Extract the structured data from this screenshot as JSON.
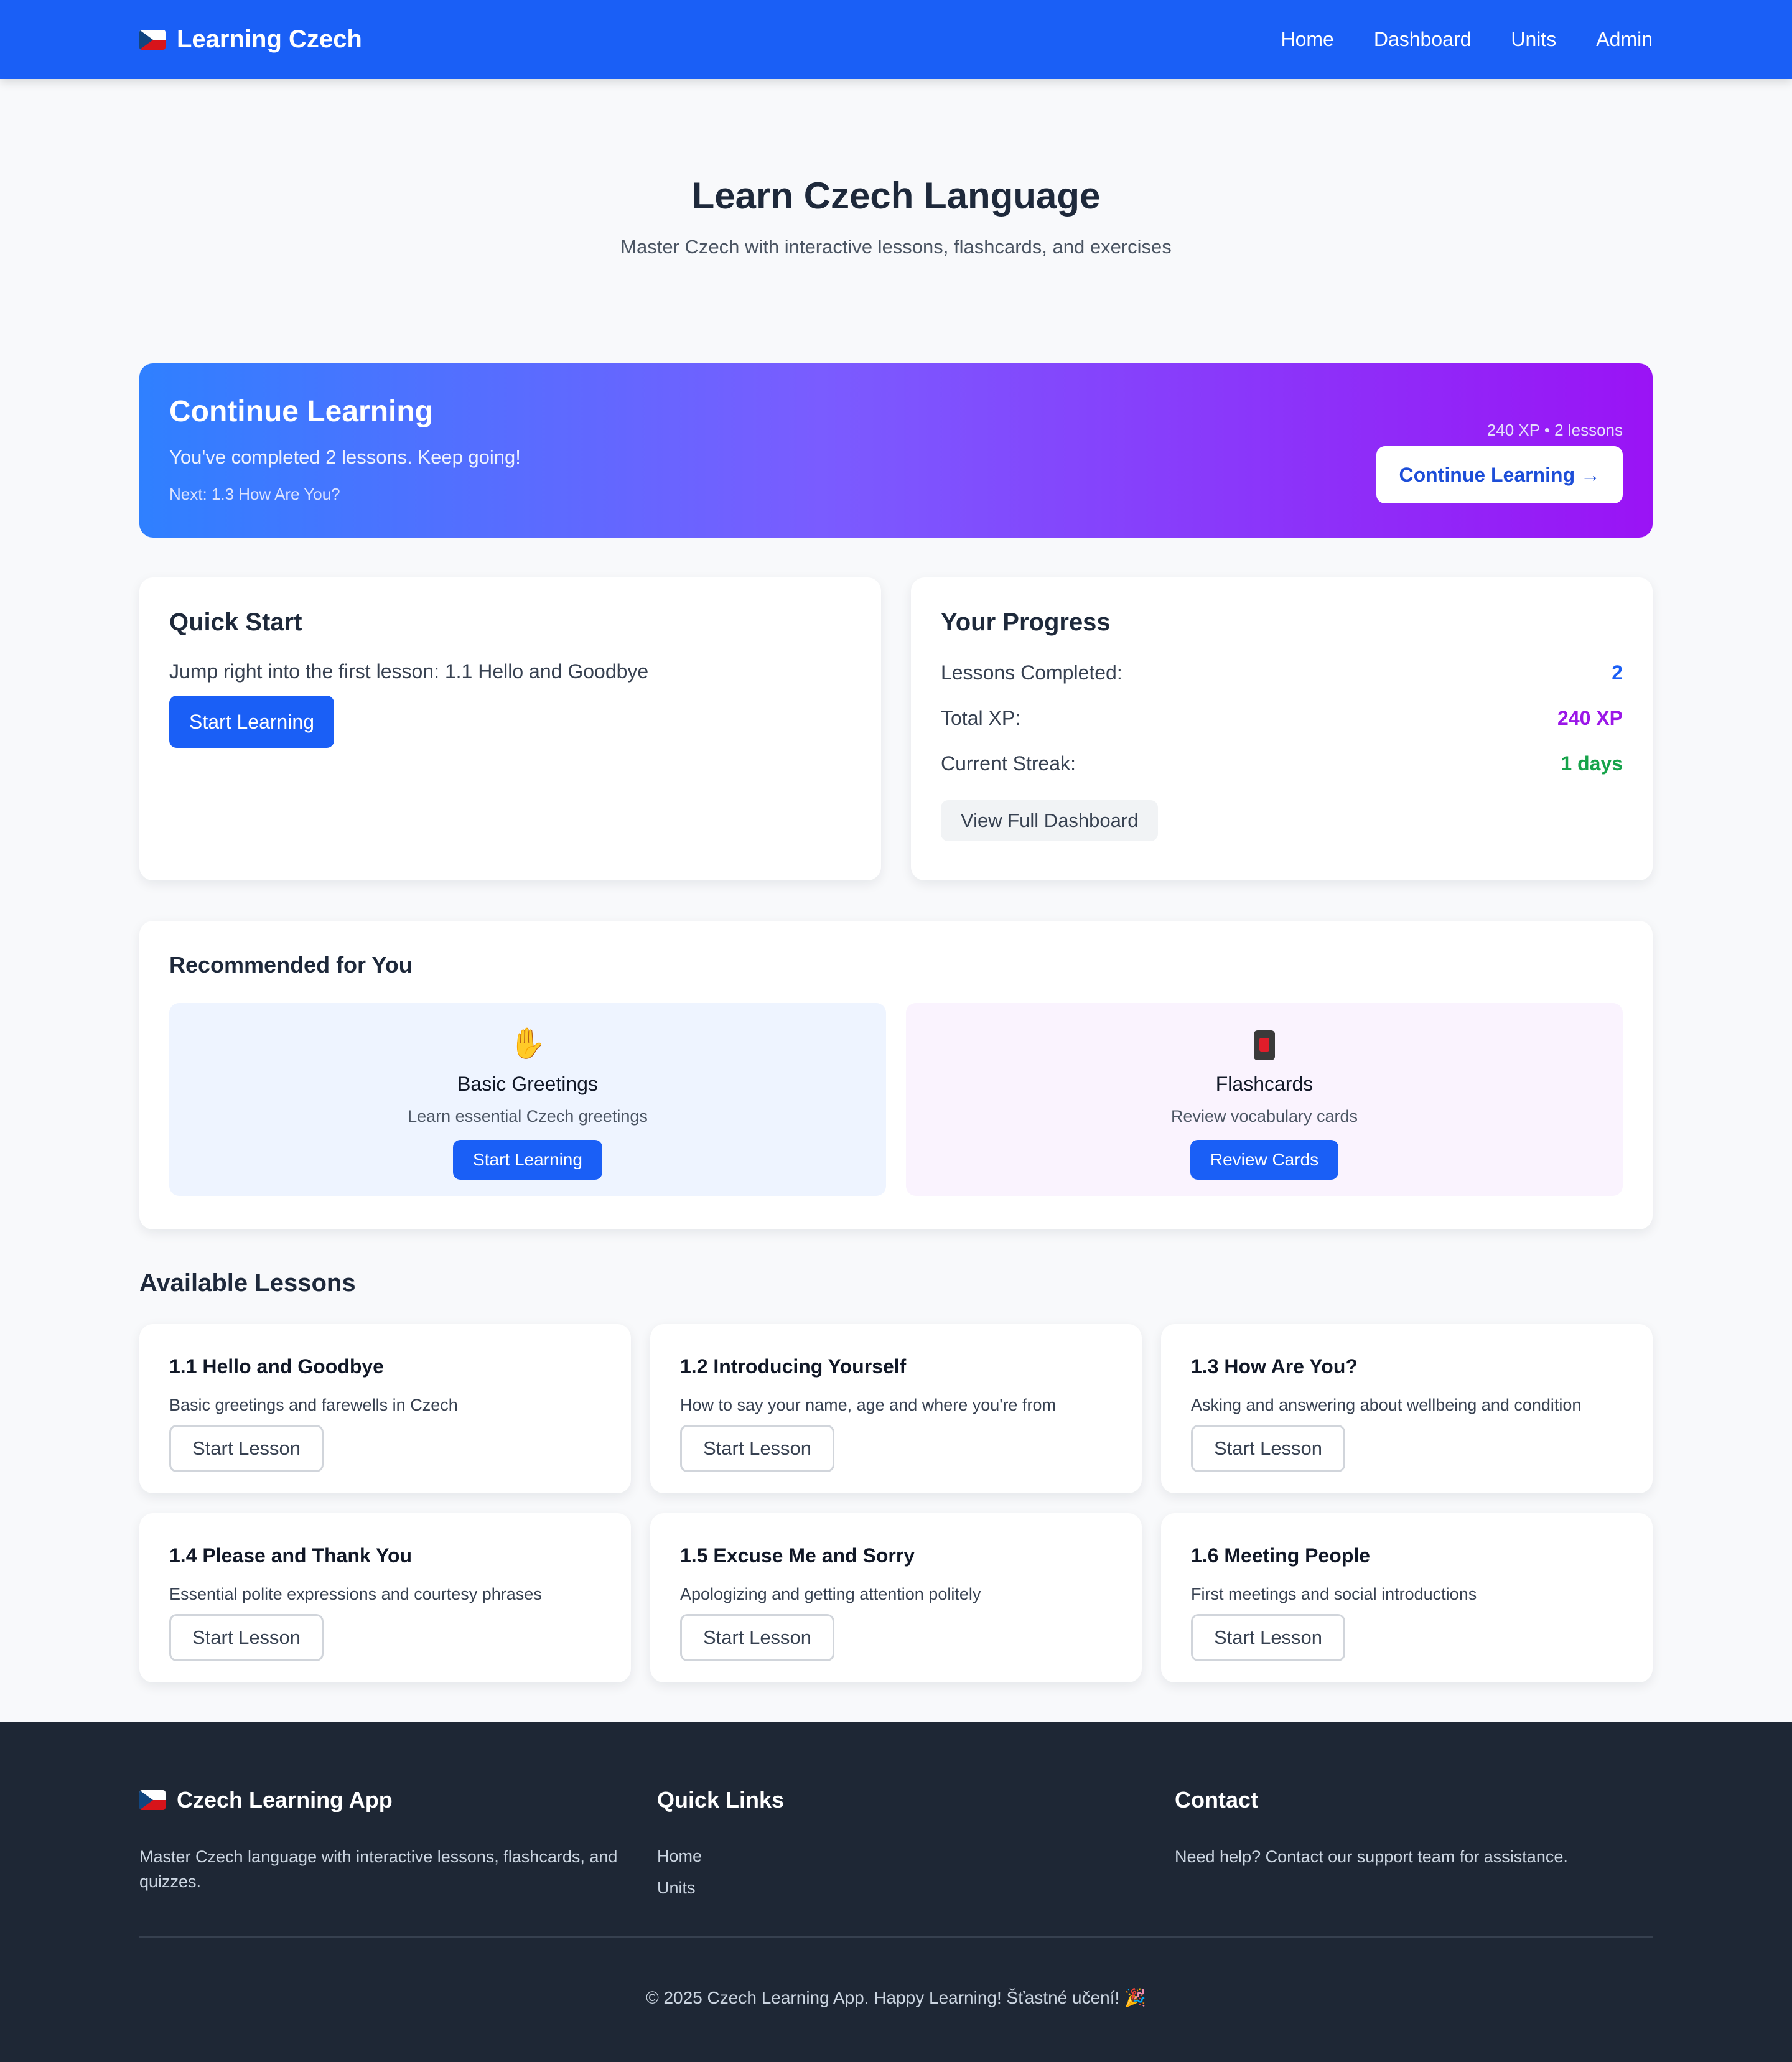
{
  "nav": {
    "brand": "Learning Czech",
    "links": [
      "Home",
      "Dashboard",
      "Units",
      "Admin"
    ]
  },
  "hero": {
    "title": "Learn Czech Language",
    "subtitle": "Master Czech with interactive lessons, flashcards, and exercises"
  },
  "continue": {
    "title": "Continue Learning",
    "subtitle": "You've completed 2 lessons. Keep going!",
    "next": "Next: 1.3 How Are You?",
    "stats": "240 XP • 2 lessons",
    "button": "Continue Learning →",
    "gradient_from": "#2f80ff",
    "gradient_to": "#9a13f5"
  },
  "quick_start": {
    "title": "Quick Start",
    "description": "Jump right into the first lesson: 1.1 Hello and Goodbye",
    "button": "Start Learning"
  },
  "progress": {
    "title": "Your Progress",
    "rows": [
      {
        "label": "Lessons Completed:",
        "value": "2"
      },
      {
        "label": "Total XP:",
        "value": "240 XP"
      },
      {
        "label": "Current Streak:",
        "value": "1 days"
      }
    ],
    "button": "View Full Dashboard"
  },
  "recommended": {
    "title": "Recommended for You",
    "items": [
      {
        "icon": "waving-hand-icon",
        "title": "Basic Greetings",
        "description": "Learn essential Czech greetings",
        "button": "Start Learning"
      },
      {
        "icon": "flashcard-icon",
        "title": "Flashcards",
        "description": "Review vocabulary cards",
        "button": "Review Cards"
      }
    ]
  },
  "lessons": {
    "title": "Available Lessons",
    "items": [
      {
        "title": "1.1 Hello and Goodbye",
        "description": "Basic greetings and farewells in Czech",
        "button": "Start Lesson"
      },
      {
        "title": "1.2 Introducing Yourself",
        "description": "How to say your name, age and where you're from",
        "button": "Start Lesson"
      },
      {
        "title": "1.3 How Are You?",
        "description": "Asking and answering about wellbeing and condition",
        "button": "Start Lesson"
      },
      {
        "title": "1.4 Please and Thank You",
        "description": "Essential polite expressions and courtesy phrases",
        "button": "Start Lesson"
      },
      {
        "title": "1.5 Excuse Me and Sorry",
        "description": "Apologizing and getting attention politely",
        "button": "Start Lesson"
      },
      {
        "title": "1.6 Meeting People",
        "description": "First meetings and social introductions",
        "button": "Start Lesson"
      }
    ]
  },
  "footer": {
    "brand": "Czech Learning App",
    "about": "Master Czech language with interactive lessons, flashcards, and quizzes.",
    "quick_links_title": "Quick Links",
    "quick_links": [
      "Home",
      "Units"
    ],
    "contact_title": "Contact",
    "contact_text": "Need help? Contact our support team for assistance.",
    "copyright": "© 2025 Czech Learning App. Happy Learning! Šťastné učení! 🎉"
  },
  "colors": {
    "primary": "#1a5ff6",
    "xp_purple": "#9b16e8",
    "streak_green": "#16a34a",
    "footer_bg": "#1e2735"
  }
}
